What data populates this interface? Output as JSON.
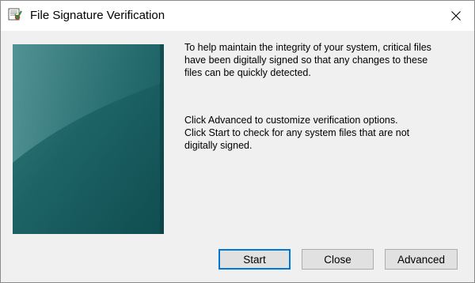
{
  "window": {
    "title": "File Signature Verification",
    "title_icon": "certificate-check-icon",
    "close_icon": "close-icon"
  },
  "banner": {
    "image": "teal-gradient-banner"
  },
  "content": {
    "paragraph1": [
      "To help maintain the integrity of your system, critical files",
      "have been digitally signed so that any changes to these",
      "files can be quickly detected."
    ],
    "paragraph2": [
      "Click Advanced to customize verification options.",
      "Click Start to check for any system files that are not",
      "digitally signed."
    ]
  },
  "buttons": {
    "start": "Start",
    "close": "Close",
    "advanced": "Advanced"
  },
  "colors": {
    "accent": "#0078d7",
    "banner_dark": "#0c4a4d",
    "banner_light": "#3d8083"
  }
}
